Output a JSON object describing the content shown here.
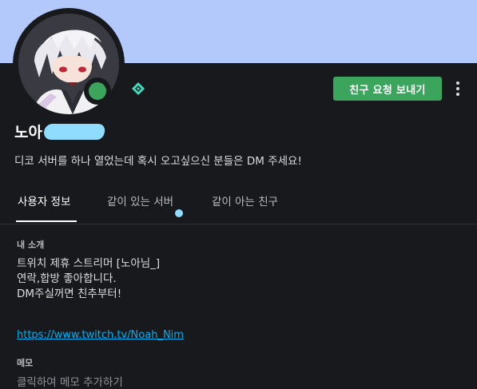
{
  "profile": {
    "username_visible": "노아",
    "status_color": "#3ba55d",
    "banner_color": "#b3c8fb",
    "custom_status": "디코 서버를 하나 열었는데 혹시 오고싶으신 분들은 DM 주세요!"
  },
  "actions": {
    "friend_request_label": "친구 요청 보내기",
    "more_icon": "more-vertical-icon"
  },
  "tabs": [
    {
      "label": "사용자 정보",
      "active": true
    },
    {
      "label": "같이 있는 서버",
      "active": false
    },
    {
      "label": "같이 아는 친구",
      "active": false
    }
  ],
  "about": {
    "title": "내 소개",
    "lines": [
      "트위치 제휴 스트리머 [노아님_]",
      "연락,합방 좋아합니다.",
      "DM주실꺼면 친추부터!"
    ],
    "link": "https://www.twitch.tv/Noah_Nim"
  },
  "memo": {
    "title": "메모",
    "placeholder": "클릭하여 메모 추가하기"
  },
  "colors": {
    "accent_green": "#3ba55d",
    "link_blue": "#00aff4",
    "background": "#18191c"
  }
}
